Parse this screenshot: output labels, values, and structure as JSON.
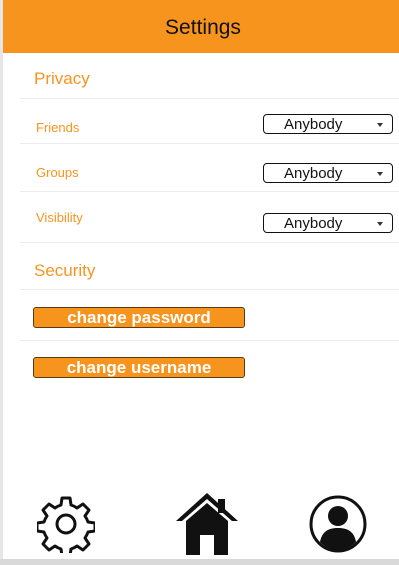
{
  "header": {
    "title": "Settings"
  },
  "privacy": {
    "title": "Privacy",
    "rows": [
      {
        "label": "Friends",
        "value": "Anybody"
      },
      {
        "label": "Groups",
        "value": "Anybody"
      },
      {
        "label": "Visibility",
        "value": "Anybody"
      }
    ]
  },
  "security": {
    "title": "Security",
    "change_password": "change password",
    "change_username": "change username"
  },
  "bottom_nav": {
    "icons": [
      "gear-icon",
      "home-icon",
      "user-icon"
    ]
  },
  "colors": {
    "accent": "#f7941d",
    "text": "#111111"
  }
}
